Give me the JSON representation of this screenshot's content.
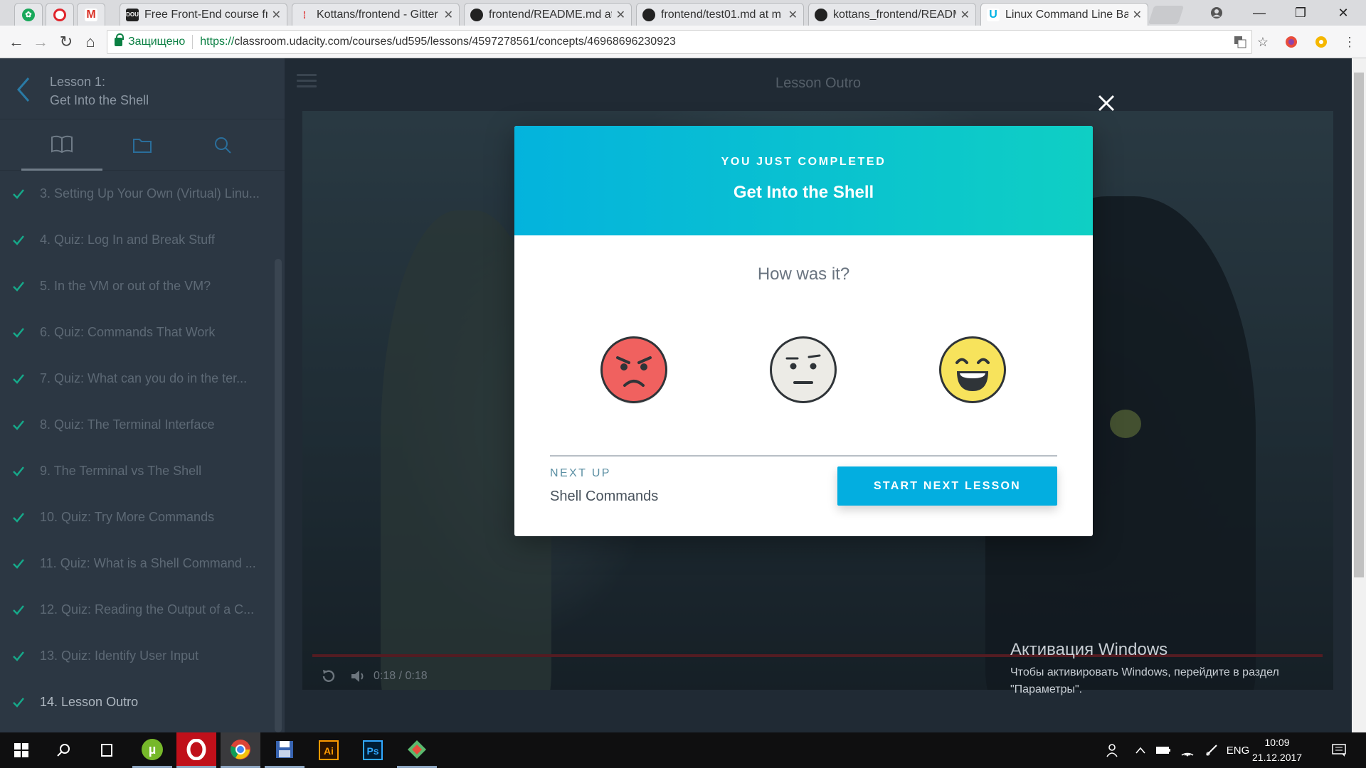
{
  "browser": {
    "tabs": [
      {
        "title": "",
        "icon": "chrome-apps-icon",
        "pinned": true
      },
      {
        "title": "",
        "icon": "opera-icon",
        "pinned": true
      },
      {
        "title": "",
        "icon": "gmail-icon",
        "pinned": true
      },
      {
        "title": "Free Front-End course fr",
        "icon": "dou-icon"
      },
      {
        "title": "Kottans/frontend - Gitter",
        "icon": "gitter-icon"
      },
      {
        "title": "frontend/README.md at",
        "icon": "github-icon"
      },
      {
        "title": "frontend/test01.md at m",
        "icon": "github-icon"
      },
      {
        "title": "kottans_frontend/READM",
        "icon": "github-icon"
      },
      {
        "title": "Linux Command Line Bas",
        "icon": "udacity-icon",
        "active": true
      }
    ],
    "secure_label": "Защищено",
    "url_scheme": "https://",
    "url_rest": "classroom.udacity.com/courses/ud595/lessons/4597278561/concepts/46968696230923"
  },
  "sidebar": {
    "lesson_label": "Lesson 1:",
    "lesson_name": "Get Into the Shell",
    "tabs": [
      "book-icon",
      "folder-icon",
      "search-icon"
    ],
    "items": [
      "3. Setting Up Your Own (Virtual) Linu...",
      "4. Quiz: Log In and Break Stuff",
      "5. In the VM or out of the VM?",
      "6. Quiz: Commands That Work",
      "7. Quiz: What can you do in the ter...",
      "8. Quiz: The Terminal Interface",
      "9. The Terminal vs The Shell",
      "10. Quiz: Try More Commands",
      "11. Quiz: What is a Shell Command ...",
      "12. Quiz: Reading the Output of a C...",
      "13. Quiz: Identify User Input",
      "14. Lesson Outro"
    ]
  },
  "main": {
    "title": "Lesson Outro",
    "video": {
      "time": "0:18 / 0:18",
      "progress": 1.0
    }
  },
  "modal": {
    "subtitle": "YOU JUST COMPLETED",
    "title": "Get Into the Shell",
    "question": "How was it?",
    "ratings": [
      "angry-face-icon",
      "neutral-face-icon",
      "happy-face-icon"
    ],
    "next_label": "NEXT UP",
    "next_title": "Shell Commands",
    "start_button": "START NEXT LESSON",
    "colors": {
      "header_start": "#04b3dd",
      "header_end": "#0fcfc4",
      "button": "#03aee0"
    }
  },
  "watermark": {
    "line1": "Активация Windows",
    "line2": "Чтобы активировать Windows, перейдите в раздел",
    "line3": "\"Параметры\"."
  },
  "taskbar": {
    "lang": "ENG",
    "time": "10:09",
    "date": "21.12.2017"
  }
}
